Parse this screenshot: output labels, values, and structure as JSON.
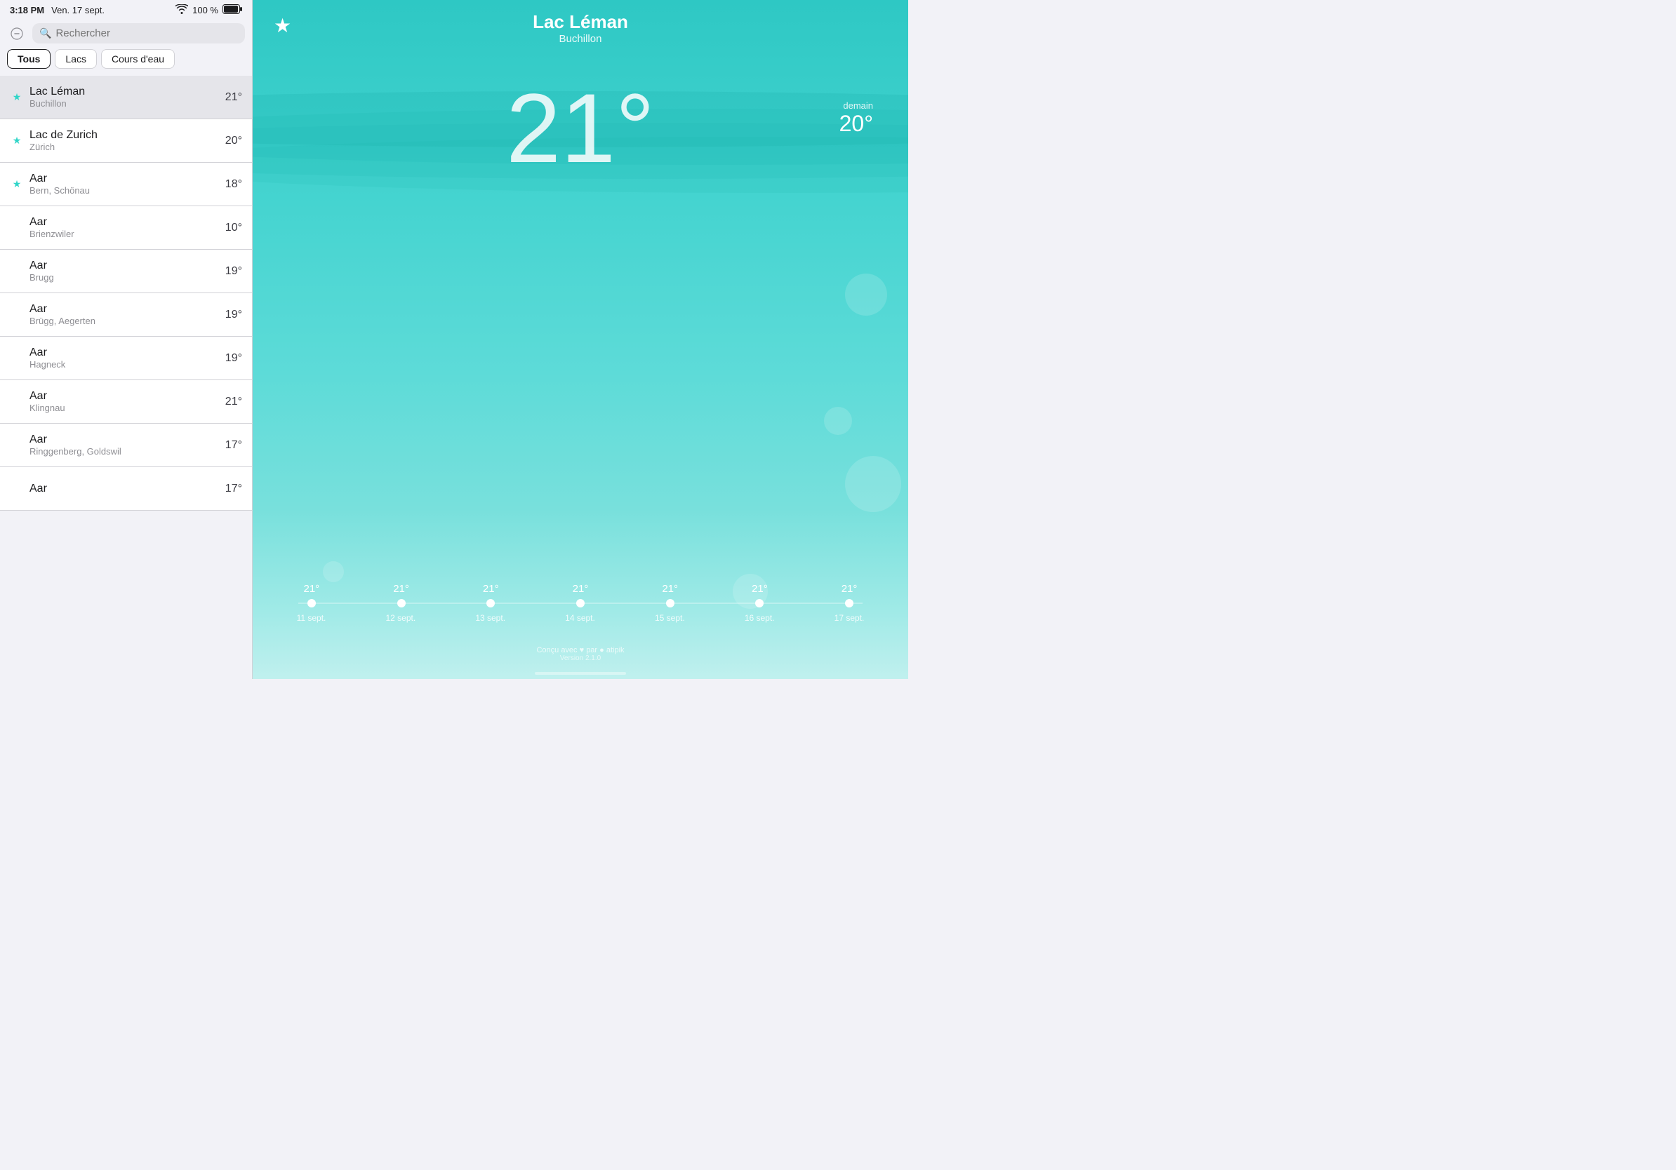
{
  "statusBar": {
    "time": "3:18 PM",
    "date": "Ven. 17 sept.",
    "battery": "100 %"
  },
  "search": {
    "placeholder": "Rechercher"
  },
  "filters": [
    {
      "id": "tous",
      "label": "Tous",
      "active": true
    },
    {
      "id": "lacs",
      "label": "Lacs",
      "active": false
    },
    {
      "id": "cours",
      "label": "Cours d'eau",
      "active": false
    }
  ],
  "listItems": [
    {
      "name": "Lac Léman",
      "sub": "Buchillon",
      "temp": "21°",
      "starred": true,
      "selected": true
    },
    {
      "name": "Lac de Zurich",
      "sub": "Zürich",
      "temp": "20°",
      "starred": true,
      "selected": false
    },
    {
      "name": "Aar",
      "sub": "Bern, Schönau",
      "temp": "18°",
      "starred": true,
      "selected": false
    },
    {
      "name": "Aar",
      "sub": "Brienzwiler",
      "temp": "10°",
      "starred": false,
      "selected": false
    },
    {
      "name": "Aar",
      "sub": "Brugg",
      "temp": "19°",
      "starred": false,
      "selected": false
    },
    {
      "name": "Aar",
      "sub": "Brügg, Aegerten",
      "temp": "19°",
      "starred": false,
      "selected": false
    },
    {
      "name": "Aar",
      "sub": "Hagneck",
      "temp": "19°",
      "starred": false,
      "selected": false
    },
    {
      "name": "Aar",
      "sub": "Klingnau",
      "temp": "21°",
      "starred": false,
      "selected": false
    },
    {
      "name": "Aar",
      "sub": "Ringgenberg, Goldswil",
      "temp": "17°",
      "starred": false,
      "selected": false
    },
    {
      "name": "Aar",
      "sub": "",
      "temp": "17°",
      "starred": false,
      "selected": false
    }
  ],
  "detail": {
    "lakeName": "Lac Léman",
    "location": "Buchillon",
    "currentTemp": "21°",
    "tomorrowLabel": "demain",
    "tomorrowTemp": "20°"
  },
  "chart": {
    "points": [
      {
        "temp": "21°",
        "date": "11 sept."
      },
      {
        "temp": "21°",
        "date": "12 sept."
      },
      {
        "temp": "21°",
        "date": "13 sept."
      },
      {
        "temp": "21°",
        "date": "14 sept."
      },
      {
        "temp": "21°",
        "date": "15 sept."
      },
      {
        "temp": "21°",
        "date": "16 sept."
      },
      {
        "temp": "21°",
        "date": "17 sept."
      }
    ]
  },
  "footer": {
    "credit": "Conçu avec ♥ par ● atipik",
    "version": "Version 2.1.0"
  }
}
